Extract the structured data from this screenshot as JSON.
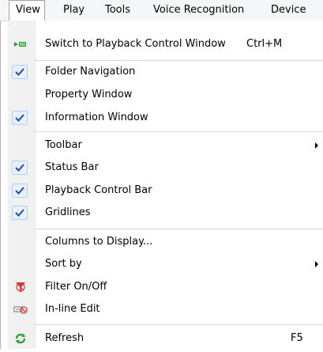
{
  "menubar": {
    "items": [
      {
        "label": "View"
      },
      {
        "label": "Play"
      },
      {
        "label": "Tools"
      },
      {
        "label": "Voice Recognition"
      },
      {
        "label": "Device"
      }
    ]
  },
  "menu": {
    "items": [
      {
        "label": "Switch to Playback Control Window",
        "shortcut": "Ctrl+M",
        "icon": "playback-window-icon",
        "checked": false
      },
      {
        "label": "Folder Navigation",
        "checked": true
      },
      {
        "label": "Property Window",
        "checked": false
      },
      {
        "label": "Information Window",
        "checked": true
      },
      {
        "label": "Toolbar",
        "submenu": true
      },
      {
        "label": "Status Bar",
        "checked": true
      },
      {
        "label": "Playback Control Bar",
        "checked": true
      },
      {
        "label": "Gridlines",
        "checked": true
      },
      {
        "label": "Columns to Display...",
        "checked": false
      },
      {
        "label": "Sort by",
        "submenu": true
      },
      {
        "label": "Filter On/Off",
        "icon": "filter-icon"
      },
      {
        "label": "In-line Edit",
        "icon": "inline-edit-icon"
      },
      {
        "label": "Refresh",
        "shortcut": "F5",
        "icon": "refresh-icon"
      }
    ]
  },
  "colors": {
    "check": "#1c4fa0",
    "checkbox_bg": "#e8f0fb",
    "checkbox_border": "#aecff7",
    "refresh_green": "#2e9d3a",
    "filter_red": "#d23a3a"
  }
}
